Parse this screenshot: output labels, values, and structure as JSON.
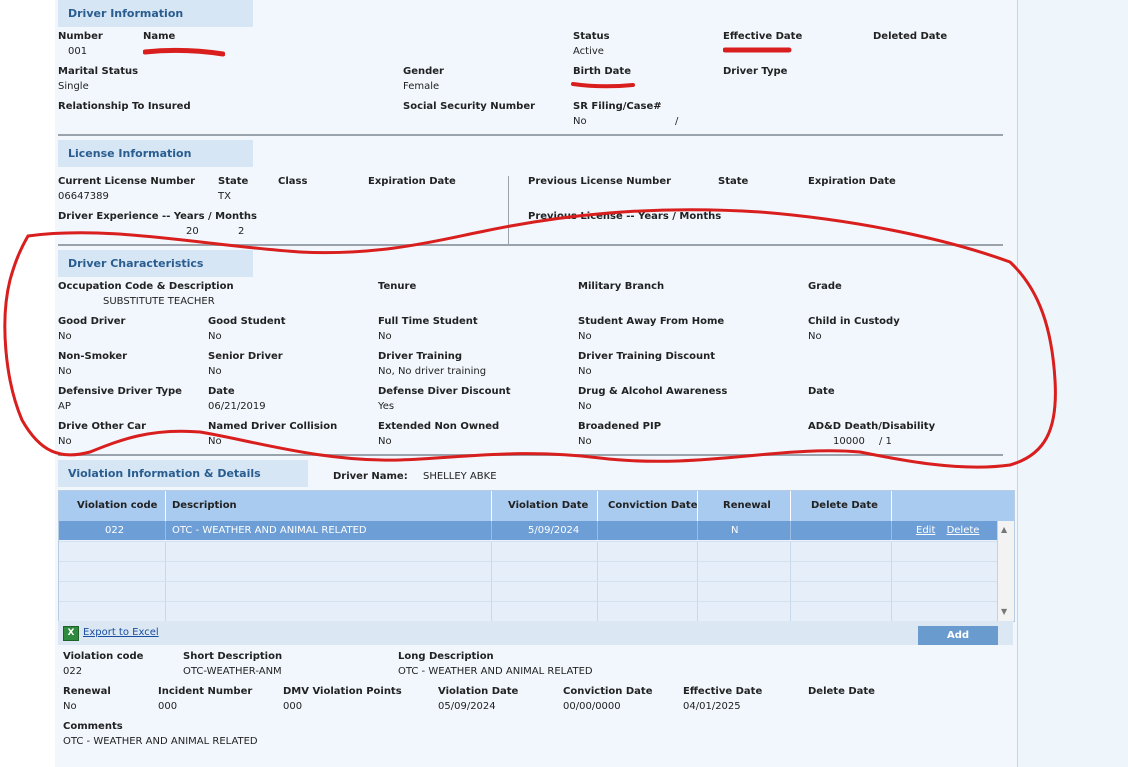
{
  "driver_info": {
    "header": "Driver Information",
    "number_label": "Number",
    "number": "001",
    "name_label": "Name",
    "status_label": "Status",
    "status": "Active",
    "effective_label": "Effective Date",
    "deleted_label": "Deleted Date",
    "marital_label": "Marital Status",
    "marital": "Single",
    "gender_label": "Gender",
    "gender": "Female",
    "birth_label": "Birth Date",
    "driver_type_label": "Driver Type",
    "relationship_label": "Relationship To Insured",
    "ssn_label": "Social Security Number",
    "sr_label": "SR Filing/Case#",
    "sr_value": "No",
    "sr_sep": "/"
  },
  "license_info": {
    "header": "License Information",
    "current_label": "Current License Number",
    "current": "06647389",
    "state_label": "State",
    "state": "TX",
    "class_label": "Class",
    "exp_label": "Expiration Date",
    "exp_years_label": "Driver Experience -- Years / Months",
    "exp_years": "20",
    "exp_months": "2",
    "prev_label": "Previous License Number",
    "prev_state_label": "State",
    "prev_exp_label": "Expiration Date",
    "prev_years_label": "Previous License -- Years / Months"
  },
  "characteristics": {
    "header": "Driver Characteristics",
    "occupation_label": "Occupation Code & Description",
    "occupation": "SUBSTITUTE TEACHER",
    "tenure_label": "Tenure",
    "military_label": "Military Branch",
    "grade_label": "Grade",
    "good_driver_label": "Good Driver",
    "good_driver": "No",
    "good_student_label": "Good Student",
    "good_student": "No",
    "full_time_label": "Full Time Student",
    "full_time": "No",
    "away_label": "Student Away From Home",
    "away": "No",
    "custody_label": "Child in Custody",
    "custody": "No",
    "non_smoker_label": "Non-Smoker",
    "non_smoker": "No",
    "senior_label": "Senior Driver",
    "senior": "No",
    "training_label": "Driver Training",
    "training": "No, No driver training",
    "training_disc_label": "Driver Training Discount",
    "training_disc": "No",
    "defensive_type_label": "Defensive Driver Type",
    "defensive_type": "AP",
    "date_label": "Date",
    "date": "06/21/2019",
    "defense_disc_label": "Defense Diver Discount",
    "defense_disc": "Yes",
    "drug_label": "Drug & Alcohol Awareness",
    "drug": "No",
    "date2_label": "Date",
    "other_car_label": "Drive Other Car",
    "other_car": "No",
    "named_label": "Named Driver Collision",
    "named": "No",
    "ext_label": "Extended Non Owned",
    "ext": "No",
    "pip_label": "Broadened PIP",
    "pip": "No",
    "add_label": "AD&D Death/Disability",
    "add_value": "10000",
    "add_sep": "/ 1"
  },
  "violations": {
    "header": "Violation Information & Details",
    "driver_name_label": "Driver Name:",
    "driver_name": "SHELLEY ABKE",
    "columns": [
      "Violation code",
      "Description",
      "Violation Date",
      "Conviction Date",
      "Renewal",
      "Delete Date"
    ],
    "row": {
      "code": "022",
      "description": "OTC - WEATHER AND ANIMAL RELATED",
      "violation_date": "5/09/2024",
      "conviction_date": "",
      "renewal": "N",
      "delete_date": "",
      "edit": "Edit",
      "delete": "Delete"
    },
    "export": "Export to Excel",
    "add": "Add"
  },
  "details": {
    "code_label": "Violation code",
    "code": "022",
    "short_label": "Short Description",
    "short": "OTC-WEATHER-ANM",
    "long_label": "Long Description",
    "long": "OTC - WEATHER AND ANIMAL RELATED",
    "renewal_label": "Renewal",
    "renewal": "No",
    "incident_label": "Incident Number",
    "incident": "000",
    "points_label": "DMV Violation Points",
    "points": "000",
    "vdate_label": "Violation Date",
    "vdate": "05/09/2024",
    "cdate_label": "Conviction Date",
    "cdate": "00/00/0000",
    "edate_label": "Effective Date",
    "edate": "04/01/2025",
    "ddate_label": "Delete Date",
    "comments_label": "Comments",
    "comments": "OTC - WEATHER AND ANIMAL RELATED"
  },
  "colors": {
    "panel": "#f1f7fd",
    "header_bg": "#d6e6f5",
    "header_text": "#2a5d8f",
    "grid_header": "#a9cbef",
    "selected_row": "#6d9ed6",
    "annotation": "#d91e1e"
  }
}
